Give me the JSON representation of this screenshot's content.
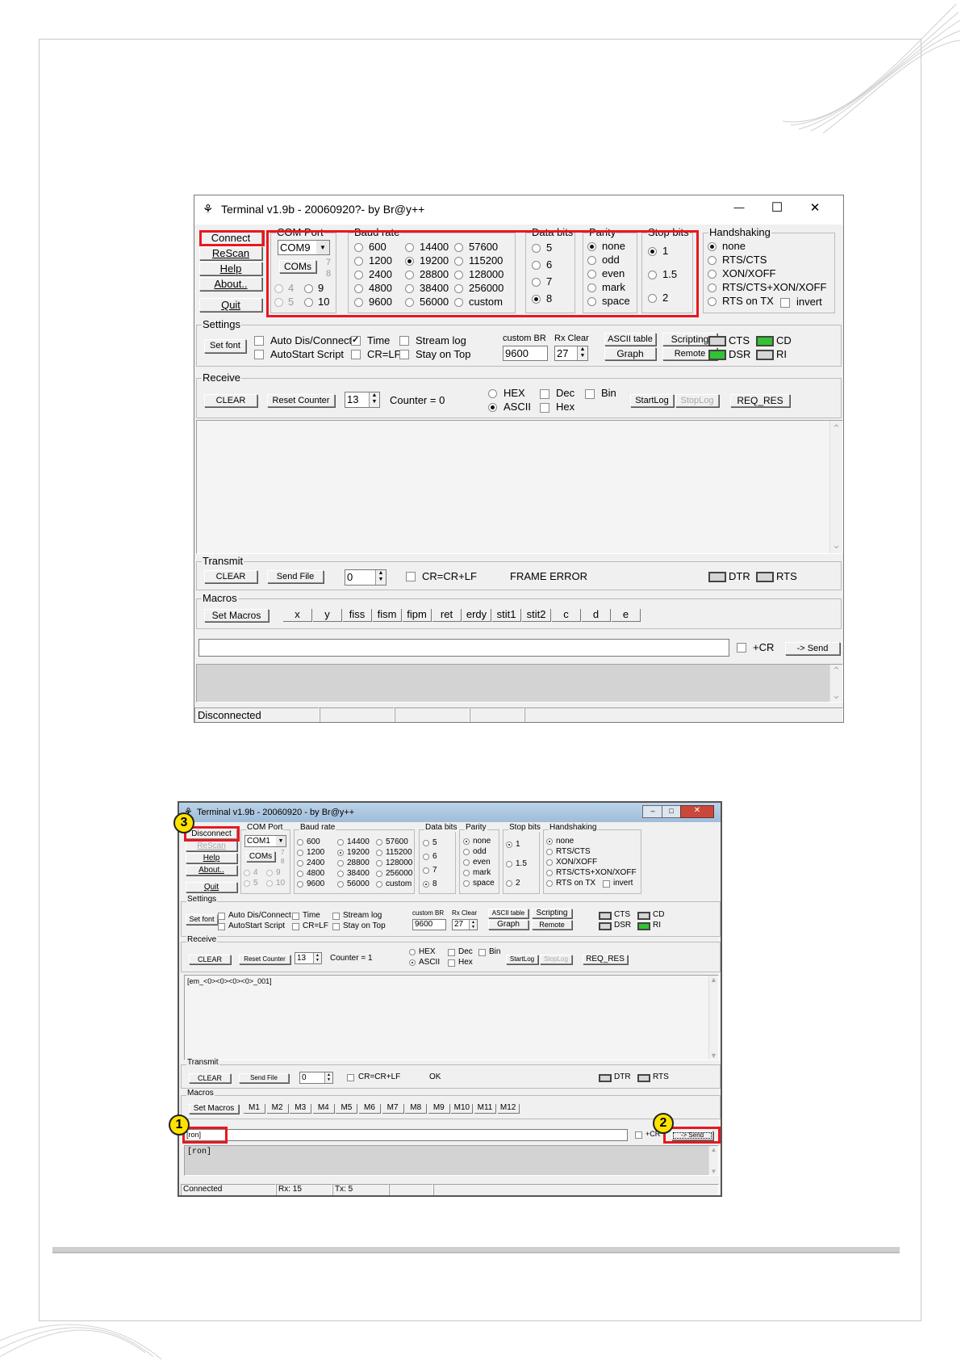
{
  "window1": {
    "title": "Terminal v1.9b - 20060920?- by Br@y++",
    "caption_minimize": "—",
    "caption_maximize": "☐",
    "caption_close": "✕",
    "left_buttons": [
      "Connect",
      "ReScan",
      "Help",
      "About..",
      "Quit"
    ],
    "com_port": {
      "label": "COM Port",
      "value": "COM9",
      "coms_button": "COMs",
      "ports": [
        "7",
        "8",
        "4",
        "9",
        "5",
        "10"
      ],
      "selected": "COM9"
    },
    "baud_rate": {
      "label": "Baud rate",
      "options": [
        "600",
        "1200",
        "2400",
        "4800",
        "9600",
        "14400",
        "19200",
        "28800",
        "38400",
        "56000",
        "57600",
        "115200",
        "128000",
        "256000",
        "custom"
      ],
      "selected": "19200"
    },
    "data_bits": {
      "label": "Data bits",
      "options": [
        "5",
        "6",
        "7",
        "8"
      ],
      "selected": "8"
    },
    "parity": {
      "label": "Parity",
      "options": [
        "none",
        "odd",
        "even",
        "mark",
        "space"
      ],
      "selected": "none"
    },
    "stop_bits": {
      "label": "Stop bits",
      "options": [
        "1",
        "1.5",
        "2"
      ],
      "selected": "1"
    },
    "handshaking": {
      "label": "Handshaking",
      "options": [
        "none",
        "RTS/CTS",
        "XON/XOFF",
        "RTS/CTS+XON/XOFF",
        "RTS on TX"
      ],
      "selected": "none",
      "invert": "invert"
    },
    "settings": {
      "label": "Settings",
      "set_font": "Set font",
      "checks": [
        {
          "label": "Auto Dis/Connect",
          "checked": false
        },
        {
          "label": "AutoStart Script",
          "checked": false
        },
        {
          "label": "Time",
          "checked": true
        },
        {
          "label": "CR=LF",
          "checked": false
        },
        {
          "label": "Stream log",
          "checked": false
        },
        {
          "label": "Stay on Top",
          "checked": false
        }
      ],
      "custom_br_label": "custom BR",
      "custom_br_value": "9600",
      "rx_clear_label": "Rx Clear",
      "rx_clear_value": "27",
      "ascii_table": "ASCII table",
      "graph": "Graph",
      "scripting": "Scripting",
      "remote": "Remote",
      "leds": [
        {
          "label": "CTS",
          "color": "#d6d6d6"
        },
        {
          "label": "CD",
          "color": "#31c331"
        },
        {
          "label": "DSR",
          "color": "#31c331"
        },
        {
          "label": "RI",
          "color": "#d6d6d6"
        }
      ]
    },
    "receive": {
      "label": "Receive",
      "clear": "CLEAR",
      "reset_counter": "Reset Counter",
      "counter_spin": "13",
      "counter_text": "Counter =  0",
      "hex": "HEX",
      "ascii": "ASCII",
      "format_selected": "ASCII",
      "dec": "Dec",
      "hex2": "Hex",
      "bin": "Bin",
      "startlog": "StartLog",
      "stoplog": "StopLog",
      "req_res": "REQ_RES",
      "content": ""
    },
    "transmit": {
      "label": "Transmit",
      "clear": "CLEAR",
      "send_file": "Send File",
      "spin": "0",
      "crcrlf": "CR=CR+LF",
      "status": "FRAME ERROR",
      "leds": [
        {
          "label": "DTR",
          "color": "#d6d6d6"
        },
        {
          "label": "RTS",
          "color": "#d6d6d6"
        }
      ]
    },
    "macros": {
      "label": "Macros",
      "set_macros": "Set Macros",
      "items": [
        "x",
        "y",
        "fiss",
        "fism",
        "fipm",
        "ret",
        "erdy",
        "stit1",
        "stit2",
        "c",
        "d",
        "e"
      ]
    },
    "send_bar": {
      "input": "",
      "cr_label": "+CR",
      "send": "-> Send"
    },
    "output_area": "",
    "status": [
      "Disconnected",
      "",
      "",
      "",
      ""
    ]
  },
  "window2": {
    "title": "Terminal v1.9b - 20060920 - by Br@y++",
    "left_buttons": [
      "Disconnect",
      "ReScan",
      "Help",
      "About..",
      "Quit"
    ],
    "com_port": {
      "label": "COM Port",
      "value": "COM1",
      "coms_button": "COMs",
      "ports": [
        "7",
        "8",
        "4",
        "9",
        "5",
        "10"
      ]
    },
    "baud_rate": {
      "label": "Baud rate",
      "options": [
        "600",
        "1200",
        "2400",
        "4800",
        "9600",
        "14400",
        "19200",
        "28800",
        "38400",
        "56000",
        "57600",
        "115200",
        "128000",
        "256000",
        "custom"
      ],
      "selected": "19200"
    },
    "data_bits": {
      "label": "Data bits",
      "options": [
        "5",
        "6",
        "7",
        "8"
      ],
      "selected": "8"
    },
    "parity": {
      "label": "Parity",
      "options": [
        "none",
        "odd",
        "even",
        "mark",
        "space"
      ],
      "selected": "none"
    },
    "stop_bits": {
      "label": "Stop bits",
      "options": [
        "1",
        "1.5",
        "2"
      ],
      "selected": "1"
    },
    "handshaking": {
      "label": "Handshaking",
      "options": [
        "none",
        "RTS/CTS",
        "XON/XOFF",
        "RTS/CTS+XON/XOFF",
        "RTS on TX"
      ],
      "selected": "none",
      "invert": "invert"
    },
    "settings": {
      "label": "Settings",
      "set_font": "Set font",
      "checks": [
        {
          "label": "Auto Dis/Connect",
          "checked": false
        },
        {
          "label": "AutoStart Script",
          "checked": false
        },
        {
          "label": "Time",
          "checked": false
        },
        {
          "label": "CR=LF",
          "checked": false
        },
        {
          "label": "Stream log",
          "checked": false
        },
        {
          "label": "Stay on Top",
          "checked": false
        }
      ],
      "custom_br_label": "custom BR",
      "custom_br_value": "9600",
      "rx_clear_label": "Rx Clear",
      "rx_clear_value": "27",
      "ascii_table": "ASCII table",
      "graph": "Graph",
      "scripting": "Scripting",
      "remote": "Remote",
      "leds": [
        {
          "label": "CTS",
          "color": "#d6d6d6"
        },
        {
          "label": "CD",
          "color": "#d6d6d6"
        },
        {
          "label": "DSR",
          "color": "#d6d6d6"
        },
        {
          "label": "RI",
          "color": "#31c331"
        }
      ]
    },
    "receive": {
      "label": "Receive",
      "clear": "CLEAR",
      "reset_counter": "Reset Counter",
      "counter_spin": "13",
      "counter_text": "Counter =  1",
      "hex": "HEX",
      "ascii": "ASCII",
      "dec": "Dec",
      "hex2": "Hex",
      "bin": "Bin",
      "startlog": "StartLog",
      "stoplog": "StopLog",
      "req_res": "REQ_RES",
      "content": "[em_<0><0><0><0>_001]"
    },
    "transmit": {
      "label": "Transmit",
      "clear": "CLEAR",
      "send_file": "Send File",
      "spin": "0",
      "crcrlf": "CR=CR+LF",
      "status": "OK",
      "leds": [
        {
          "label": "DTR",
          "color": "#d6d6d6"
        },
        {
          "label": "RTS",
          "color": "#d6d6d6"
        }
      ]
    },
    "macros": {
      "label": "Macros",
      "set_macros": "Set Macros",
      "items": [
        "M1",
        "M2",
        "M3",
        "M4",
        "M5",
        "M6",
        "M7",
        "M8",
        "M9",
        "M10",
        "M11",
        "M12"
      ]
    },
    "send_bar": {
      "input": "[ron]",
      "cr_label": "+CR",
      "send": "-> Send"
    },
    "output_area": "[ron]",
    "status": [
      "Connected",
      "Rx: 15",
      "Tx: 5",
      "",
      ""
    ]
  },
  "callouts": [
    "1",
    "2",
    "3"
  ],
  "colors": {
    "highlight": "#e8181e",
    "callout": "#ffe300",
    "led_green": "#31c331",
    "led_off": "#d6d6d6"
  }
}
